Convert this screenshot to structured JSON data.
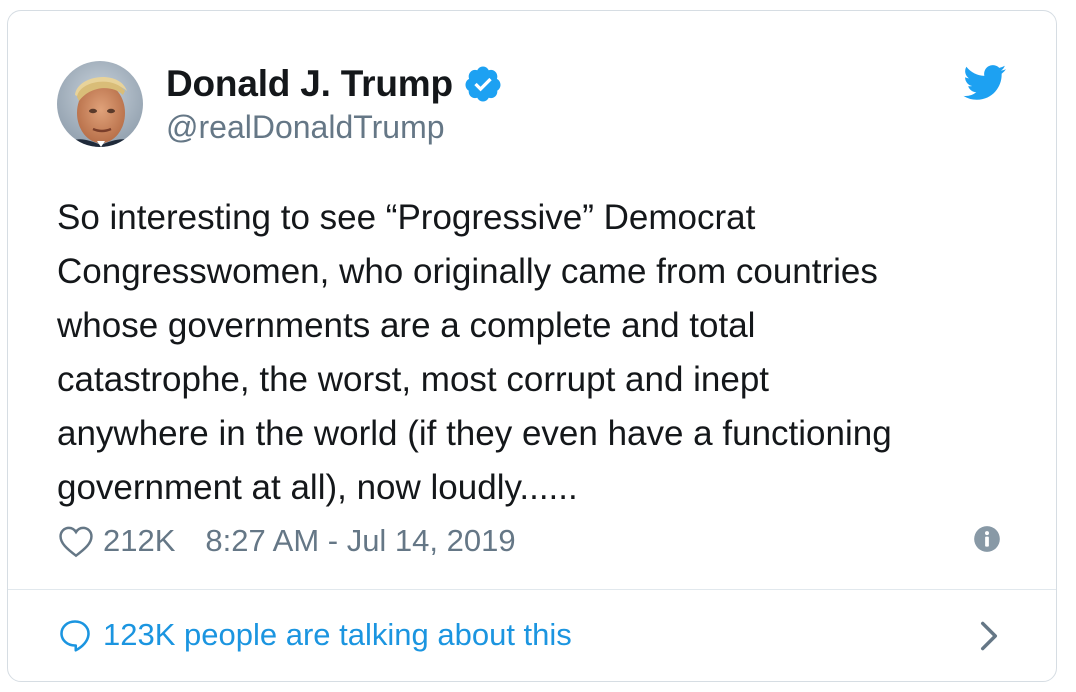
{
  "tweet": {
    "author": {
      "display_name": "Donald J. Trump",
      "handle": "@realDonaldTrump",
      "verified": true,
      "avatar_icon": "profile-photo"
    },
    "text": "So interesting to see “Progressive” Democrat\nCongresswomen, who originally came from countries\nwhose governments are a complete and total\ncatastrophe, the worst, most corrupt and inept\nanywhere in the world (if they even have a functioning\ngovernment at all), now loudly......",
    "likes": "212K",
    "timestamp": "8:27 AM - Jul 14, 2019",
    "talking": "123K people are talking about this"
  },
  "icons": {
    "brand": "twitter-bird-icon",
    "verified": "verified-badge-icon",
    "like": "heart-icon",
    "info": "info-icon",
    "reply": "speech-bubble-icon",
    "chevron": "chevron-right-icon"
  },
  "colors": {
    "accent": "#1da1f2",
    "link": "#1b95e0",
    "text": "#14171a",
    "secondary": "#657786",
    "border": "#d6dde3"
  }
}
